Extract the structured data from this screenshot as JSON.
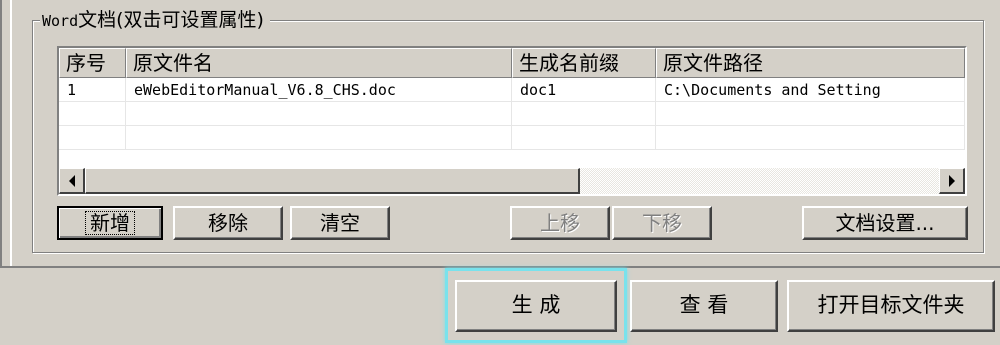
{
  "group": {
    "title_prefix": "Word",
    "title_rest": "文档(双击可设置属性)"
  },
  "list": {
    "columns": [
      "序号",
      "原文件名",
      "生成名前缀",
      "原文件路径"
    ],
    "rows": [
      [
        "1",
        "eWebEditorManual_V6.8_CHS.doc",
        "doc1",
        "C:\\Documents and Setting"
      ],
      [
        "",
        "",
        "",
        ""
      ],
      [
        "",
        "",
        "",
        ""
      ]
    ],
    "scrollbar": {
      "left_arrow": "scroll-left-arrow",
      "right_arrow": "scroll-right-arrow",
      "thumb_fraction": 0.58
    }
  },
  "buttons": {
    "add": "新增",
    "remove": "移除",
    "clear": "清空",
    "move_up": "上移",
    "move_down": "下移",
    "doc_settings": "文档设置...",
    "generate": "生 成",
    "view": "查 看",
    "open_folder": "打开目标文件夹"
  },
  "colors": {
    "face": "#d4d0c8",
    "highlight_outline": "#79e2ec"
  }
}
